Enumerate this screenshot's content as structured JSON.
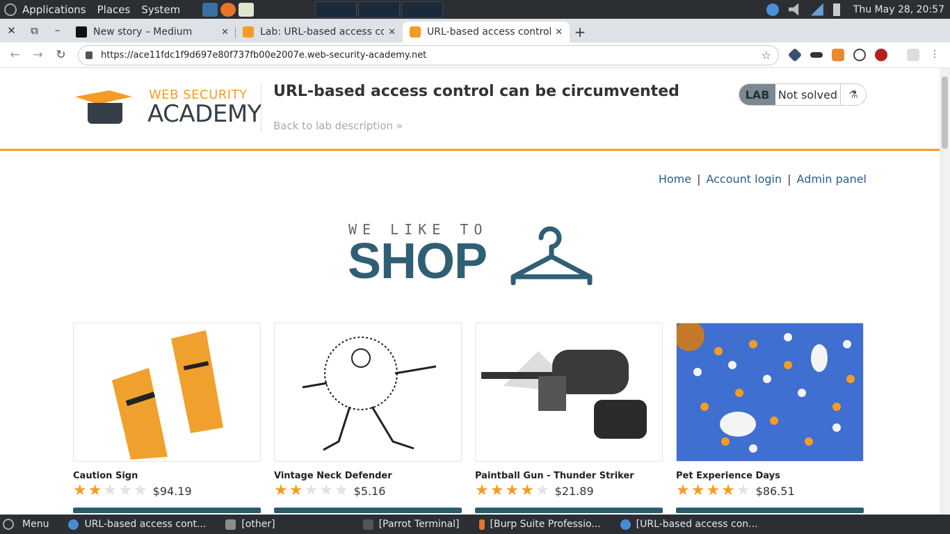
{
  "desktop": {
    "menus": [
      "Applications",
      "Places",
      "System"
    ],
    "clock": "Thu May 28, 20:57"
  },
  "browser": {
    "tabs": [
      {
        "label": "New story – Medium",
        "icon": "medium-icon"
      },
      {
        "label": "Lab: URL-based access co",
        "icon": "portswigger-icon"
      },
      {
        "label": "URL-based access control",
        "icon": "portswigger-icon"
      }
    ],
    "url": "https://ace11fdc1f9d697e80f737fb00e2007e.web-security-academy.net"
  },
  "lab": {
    "brand_top": "WEB SECURITY",
    "brand_bottom": "ACADEMY",
    "title": "URL-based access control can be circumvented",
    "back_link": "Back to lab description",
    "badge": "LAB",
    "status": "Not solved"
  },
  "nav": {
    "home": "Home",
    "login": "Account login",
    "admin": "Admin panel",
    "sep": "|"
  },
  "shop_logo": {
    "tagline": "WE LIKE TO",
    "word": "SHOP"
  },
  "products": [
    {
      "name": "Caution Sign",
      "price": "$94.19",
      "rating": 2
    },
    {
      "name": "Vintage Neck Defender",
      "price": "$5.16",
      "rating": 2
    },
    {
      "name": "Paintball Gun - Thunder Striker",
      "price": "$21.89",
      "rating": 4
    },
    {
      "name": "Pet Experience Days",
      "price": "$86.51",
      "rating": 4
    }
  ],
  "taskbar": {
    "menu": "Menu",
    "items": [
      "URL-based access cont...",
      "[other]",
      "[Parrot Terminal]",
      "[Burp Suite Professio...",
      "[URL-based access con..."
    ]
  },
  "colors": {
    "accent": "#f59c25",
    "shop": "#2f5f74",
    "link": "#2a5c8a"
  }
}
